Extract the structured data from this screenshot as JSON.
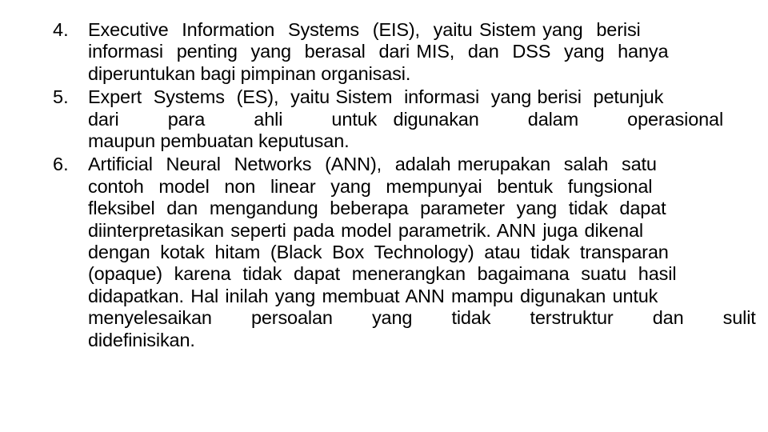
{
  "document": {
    "background_color": "#ffffff",
    "text_color": "#000000",
    "list": [
      {
        "marker": "4.",
        "lines": [
          "Executive  Information  Systems  (EIS),  yaitu Sistem yang  berisi",
          "informasi  penting  yang  berasal  dari MIS,  dan  DSS  yang  hanya",
          "diperuntukan bagi pimpinan organisasi."
        ]
      },
      {
        "marker": "5.",
        "lines": [
          "Expert  Systems  (ES),  yaitu Sistem  informasi  yang berisi  petunjuk",
          "dari   para   ahli   untuk digunakan   dalam   operasional",
          "maupun pembuatan keputusan."
        ]
      },
      {
        "marker": "6.",
        "lines": [
          "Artificial  Neural  Networks  (ANN),  adalah merupakan  salah  satu",
          "contoh  model  non  linear  yang  mempunyai  bentuk  fungsional",
          "fleksibel  dan  mengandung  beberapa  parameter  yang  tidak  dapat",
          "diinterpretasikan seperti pada model parametrik. ANN juga dikenal",
          "dengan  kotak  hitam  (Black  Box  Technology)  atau  tidak  transparan",
          "(opaque)  karena  tidak  dapat  menerangkan  bagaimana  suatu  hasil",
          "didapatkan. Hal inilah yang membuat ANN mampu digunakan untuk",
          "menyelesaikan   persoalan   yang   tidak   terstruktur   dan   sulit",
          "didefinisikan."
        ]
      }
    ]
  }
}
